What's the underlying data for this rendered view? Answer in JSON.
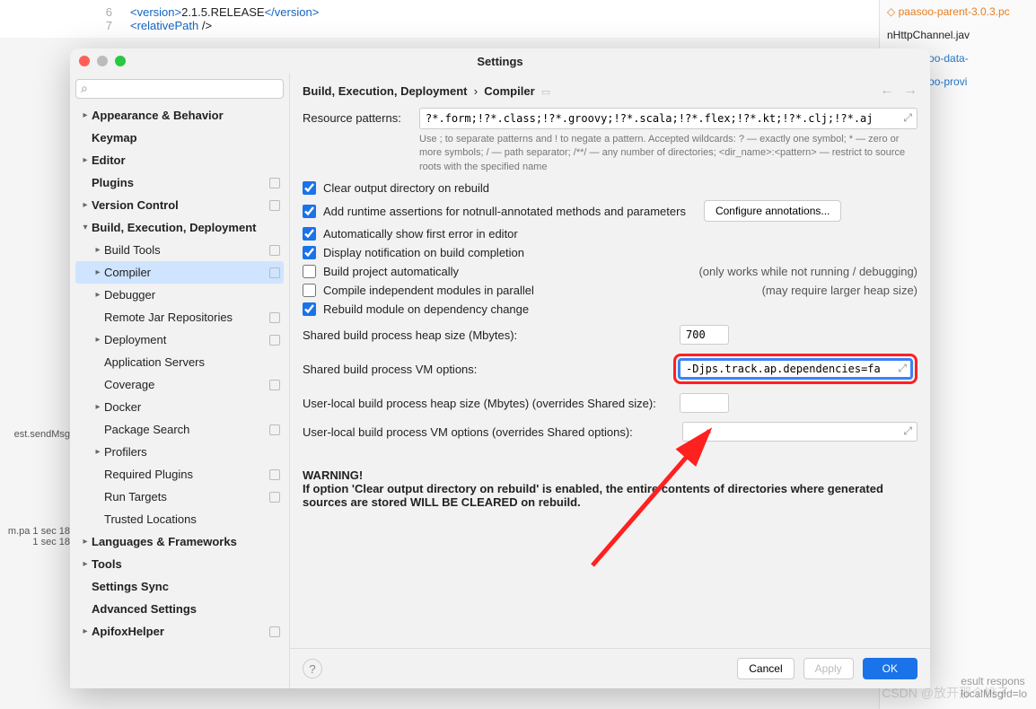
{
  "background": {
    "code_lines": [
      {
        "num": "6",
        "text_open": "<version>",
        "text_mid": "2.1.5.RELEASE",
        "text_close": "</version>"
      },
      {
        "num": "7",
        "text_open": "<relativePath",
        "text_mid": " />",
        "text_close": ""
      }
    ],
    "right_panel": [
      "paasoo-parent-3.0.3.pc",
      "nHttpChannel.jav",
      "ml (paasoo-data-",
      "ml (paasoo-provi"
    ],
    "left_status1": "est.sendMsg",
    "left_line1": "m.pa 1 sec 18",
    "left_line2": "1 sec 18",
    "bottom1": "esult respons",
    "bottom2": "localMsgId=lo",
    "watermark": "CSDN @放开那个桃子"
  },
  "dialog": {
    "title": "Settings",
    "search_placeholder": "",
    "breadcrumb_parent": "Build, Execution, Deployment",
    "breadcrumb_sep": "›",
    "breadcrumb_current": "Compiler",
    "sidebar": [
      {
        "label": "Appearance & Behavior",
        "bold": true,
        "chevron": true,
        "indent": 0
      },
      {
        "label": "Keymap",
        "bold": true,
        "indent": 0
      },
      {
        "label": "Editor",
        "bold": true,
        "chevron": true,
        "indent": 0
      },
      {
        "label": "Plugins",
        "bold": true,
        "indent": 0,
        "badge": true
      },
      {
        "label": "Version Control",
        "bold": true,
        "chevron": true,
        "indent": 0,
        "badge": true
      },
      {
        "label": "Build, Execution, Deployment",
        "bold": true,
        "chevron": true,
        "expanded": true,
        "indent": 0
      },
      {
        "label": "Build Tools",
        "chevron": true,
        "indent": 1,
        "badge": true
      },
      {
        "label": "Compiler",
        "chevron": true,
        "indent": 1,
        "selected": true,
        "badge": true
      },
      {
        "label": "Debugger",
        "chevron": true,
        "indent": 1
      },
      {
        "label": "Remote Jar Repositories",
        "indent": 1,
        "badge": true
      },
      {
        "label": "Deployment",
        "chevron": true,
        "indent": 1,
        "badge": true
      },
      {
        "label": "Application Servers",
        "indent": 1
      },
      {
        "label": "Coverage",
        "indent": 1,
        "badge": true
      },
      {
        "label": "Docker",
        "chevron": true,
        "indent": 1
      },
      {
        "label": "Package Search",
        "indent": 1,
        "badge": true
      },
      {
        "label": "Profilers",
        "chevron": true,
        "indent": 1
      },
      {
        "label": "Required Plugins",
        "indent": 1,
        "badge": true
      },
      {
        "label": "Run Targets",
        "indent": 1,
        "badge": true
      },
      {
        "label": "Trusted Locations",
        "indent": 1
      },
      {
        "label": "Languages & Frameworks",
        "bold": true,
        "chevron": true,
        "indent": 0
      },
      {
        "label": "Tools",
        "bold": true,
        "chevron": true,
        "indent": 0
      },
      {
        "label": "Settings Sync",
        "bold": true,
        "indent": 0
      },
      {
        "label": "Advanced Settings",
        "bold": true,
        "indent": 0
      },
      {
        "label": "ApifoxHelper",
        "bold": true,
        "chevron": true,
        "indent": 0,
        "badge": true
      }
    ],
    "resource_patterns_label": "Resource patterns:",
    "resource_patterns_value": "?*.form;!?*.class;!?*.groovy;!?*.scala;!?*.flex;!?*.kt;!?*.clj;!?*.aj",
    "resource_patterns_hint": "Use ; to separate patterns and ! to negate a pattern. Accepted wildcards: ? — exactly one symbol; * — zero or more symbols; / — path separator; /**/ — any number of directories; <dir_name>:<pattern> — restrict to source roots with the specified name",
    "checks": {
      "clear_output": "Clear output directory on rebuild",
      "runtime_assert": "Add runtime assertions for notnull-annotated methods and parameters",
      "configure_annotations": "Configure annotations...",
      "auto_first_error": "Automatically show first error in editor",
      "display_notif": "Display notification on build completion",
      "build_auto": "Build project automatically",
      "build_auto_note": "(only works while not running / debugging)",
      "compile_parallel": "Compile independent modules in parallel",
      "compile_parallel_note": "(may require larger heap size)",
      "rebuild_dep": "Rebuild module on dependency change"
    },
    "fields": {
      "heap_label": "Shared build process heap size (Mbytes):",
      "heap_value": "700",
      "vm_label": "Shared build process VM options:",
      "vm_value": "-Djps.track.ap.dependencies=fa",
      "user_heap_label": "User-local build process heap size (Mbytes) (overrides Shared size):",
      "user_heap_value": "",
      "user_vm_label": "User-local build process VM options (overrides Shared options):",
      "user_vm_value": ""
    },
    "warning_title": "WARNING!",
    "warning_text": "If option 'Clear output directory on rebuild' is enabled, the entire contents of directories where generated sources are stored WILL BE CLEARED on rebuild.",
    "footer": {
      "cancel": "Cancel",
      "apply": "Apply",
      "ok": "OK"
    }
  }
}
